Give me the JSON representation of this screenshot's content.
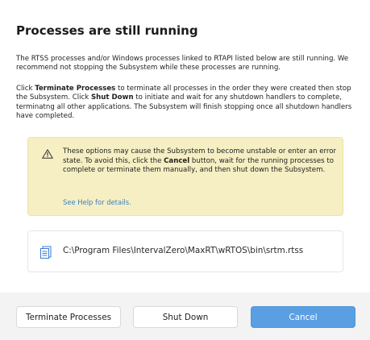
{
  "dialog": {
    "title": "Processes are still running",
    "paragraph1": "The RTSS processes and/or Windows processes linked to RTAPI listed below are still running. We recommend not stopping the Subsystem while these processes are running.",
    "paragraph2": {
      "part1": "Click ",
      "bold1": "Terminate Processes",
      "part2": " to terminate all processes in the order they were created then stop the Subsystem. Click ",
      "bold2": "Shut Down",
      "part3": " to initiate and wait for any shutdown handlers to complete, terminatng all other applications. The Subsystem will finish stopping once all shutdown handlers have completed."
    }
  },
  "warning": {
    "icon": "warning-triangle-icon",
    "part1": "These options may cause the Subsystem to become unstable or enter an error state. To avoid this, click the ",
    "bold": "Cancel",
    "part2": " button, wait for the running processes to complete or terminate them manually, and then shut down the Subsystem.",
    "help_link": "See Help for details.",
    "background_color": "#f5efc3"
  },
  "processes": [
    {
      "icon": "process-list-icon",
      "path": "C:\\Program Files\\IntervalZero\\MaxRT\\wRTOS\\bin\\srtm.rtss"
    }
  ],
  "footer": {
    "terminate_label": "Terminate Processes",
    "shutdown_label": "Shut Down",
    "cancel_label": "Cancel",
    "accent_color": "#5a9fe2"
  }
}
